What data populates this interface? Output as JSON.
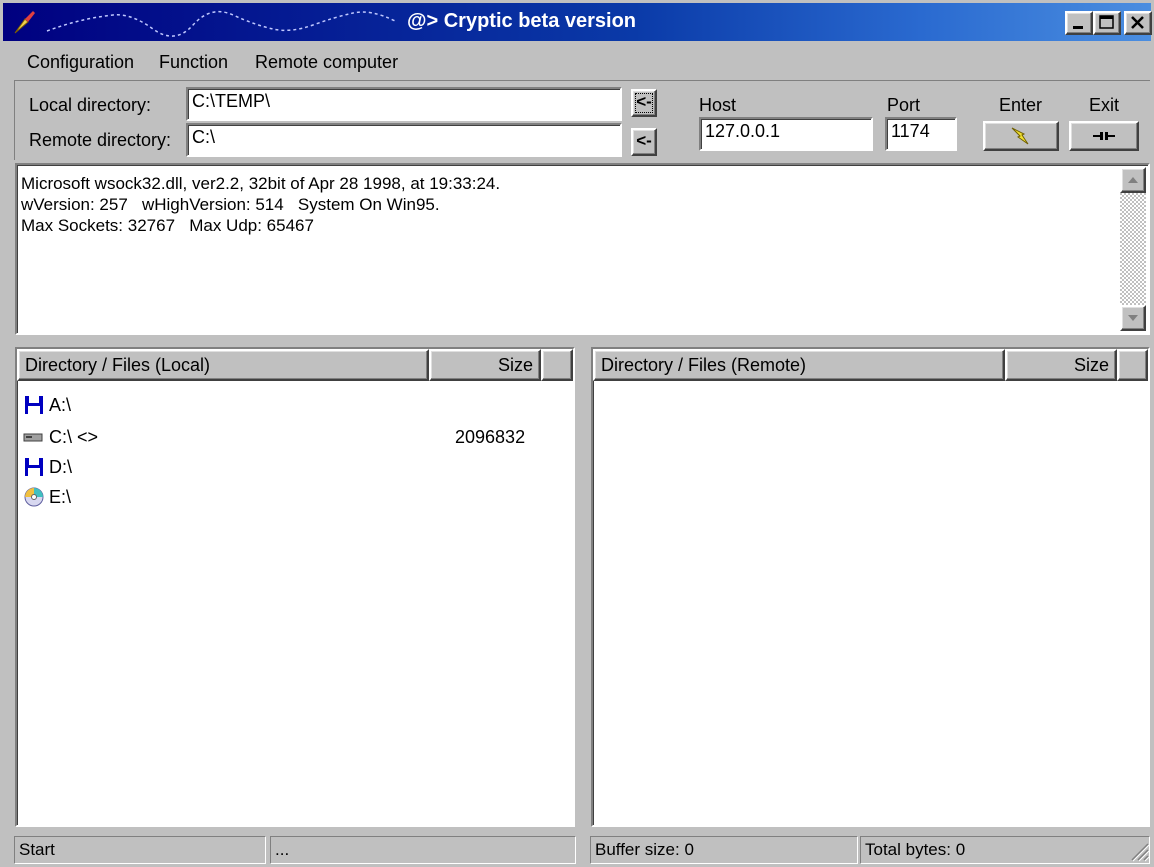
{
  "window": {
    "title": "@> Cryptic beta version",
    "controls": [
      "minimize",
      "maximize",
      "close"
    ]
  },
  "menu": [
    "Configuration",
    "Function",
    "Remote computer"
  ],
  "directories": {
    "local_label": "Local directory:",
    "local_value": "C:\\TEMP\\",
    "remote_label": "Remote directory:",
    "remote_value": "C:\\",
    "copy_local_label": "<-",
    "copy_remote_label": "<-"
  },
  "connection": {
    "host_label": "Host",
    "host_value": "127.0.0.1",
    "port_label": "Port",
    "port_value": "1174",
    "enter_label": "Enter",
    "exit_label": "Exit"
  },
  "log": {
    "lines": [
      "Microsoft wsock32.dll, ver2.2, 32bit of Apr 28 1998, at 19:33:24.",
      "wVersion: 257   wHighVersion: 514   System On Win95.",
      "Max Sockets: 32767   Max Udp: 65467"
    ]
  },
  "local_pane": {
    "col_name": "Directory / Files (Local)",
    "col_size": "Size",
    "rows": [
      {
        "name": "A:\\",
        "size": "",
        "icon": "floppy-icon"
      },
      {
        "name": "C:\\ <>",
        "size": "2096832",
        "icon": "hard-drive-icon"
      },
      {
        "name": "D:\\",
        "size": "",
        "icon": "floppy-icon"
      },
      {
        "name": "E:\\",
        "size": "",
        "icon": "cd-rom-icon"
      }
    ]
  },
  "remote_pane": {
    "col_name": "Directory / Files (Remote)",
    "col_size": "Size",
    "rows": []
  },
  "statusbar": {
    "start": "Start",
    "dots": "...",
    "buffer": "Buffer size: 0",
    "total": "Total bytes: 0"
  },
  "colors": {
    "titlebar_start": "#000080",
    "titlebar_end": "#4b8ee0",
    "face": "#c0c0c0"
  }
}
